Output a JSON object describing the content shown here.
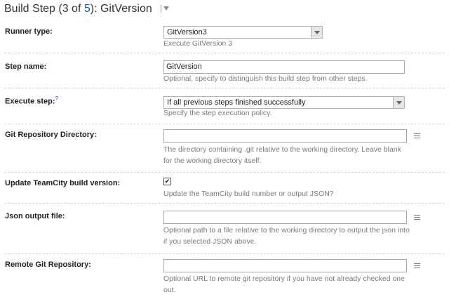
{
  "header": {
    "prefix": "Build Step (3 of ",
    "step_total": "5",
    "suffix": "): GitVersion"
  },
  "runner_type": {
    "label": "Runner type:",
    "selected": "GitVersion3",
    "hint": "Execute GitVersion 3"
  },
  "step_name": {
    "label": "Step name:",
    "value": "GitVersion",
    "hint": "Optional, specify to distinguish this build step from other steps."
  },
  "execute_step": {
    "label": "Execute step:",
    "help_mark": "?",
    "selected": "If all previous steps finished successfully",
    "hint": "Specify the step execution policy."
  },
  "git_repo_dir": {
    "label": "Git Repository Directory:",
    "value": "",
    "hint_line1": "The directory containing .git relative to the working directory. Leave blank",
    "hint_line2": "for the working directory itself."
  },
  "update_build_version": {
    "label": "Update TeamCity build version:",
    "checked": true,
    "check_mark": "✔",
    "hint": "Update the TeamCity build number or output JSON?"
  },
  "json_output": {
    "label": "Json output file:",
    "value": "",
    "hint_line1": "Optional path to a file relative to the working directory to output the json into",
    "hint_line2": "if you selected JSON above."
  },
  "remote_git_repo": {
    "label": "Remote Git Repository:",
    "value": "",
    "hint_line1": "Optional URL to remote git repository if you have not already checked one",
    "hint_line2": "out."
  }
}
